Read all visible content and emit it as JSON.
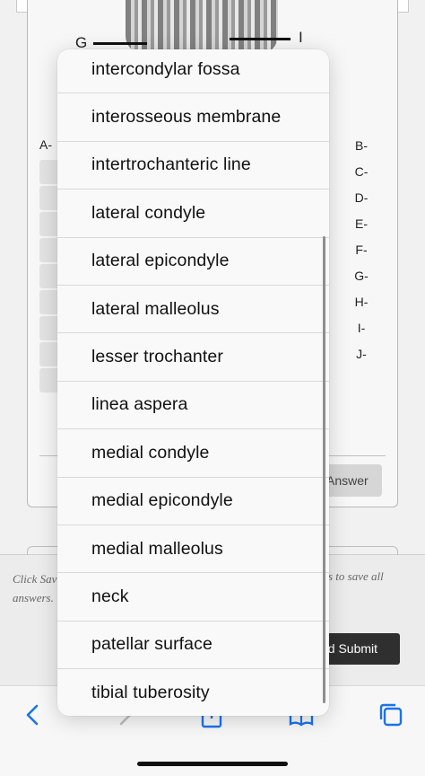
{
  "figure": {
    "labels": [
      "G",
      "I"
    ]
  },
  "matching": {
    "left_letter": "A-",
    "right_letters": [
      "B-",
      "C-",
      "D-",
      "E-",
      "F-",
      "G-",
      "H-",
      "I-",
      "J-"
    ]
  },
  "answer_button": "Answer",
  "save_bar": {
    "text_left": "Click Save answers.",
    "text_right": "s to save all",
    "submit_label": "nd Submit"
  },
  "dropdown": {
    "options": [
      "intercondylar fossa",
      "interosseous membrane",
      "intertrochanteric line",
      "lateral condyle",
      "lateral epicondyle",
      "lateral malleolus",
      "lesser trochanter",
      "linea aspera",
      "medial condyle",
      "medial epicondyle",
      "medial malleolus",
      "neck",
      "patellar surface",
      "tibial tuberosity"
    ]
  },
  "toolbar": {
    "icons": [
      "back-icon",
      "forward-icon",
      "share-icon",
      "bookmarks-icon",
      "tabs-icon"
    ],
    "accent": "#1a73e8"
  }
}
